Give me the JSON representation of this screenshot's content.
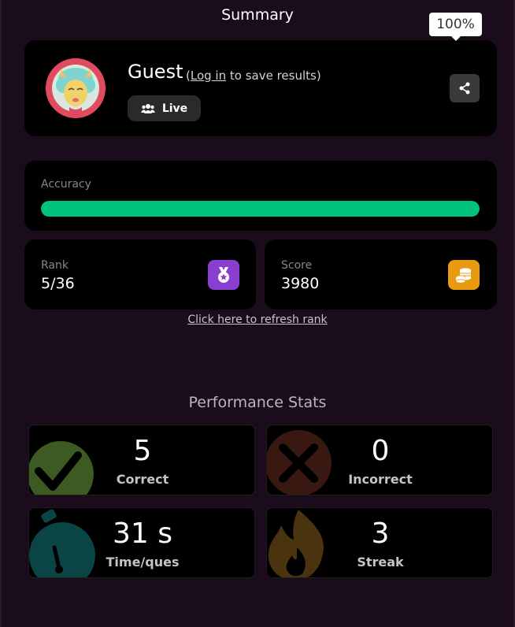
{
  "header": {
    "title": "Summary"
  },
  "profile": {
    "name": "Guest",
    "note_open": "(",
    "login_link": "Log in",
    "note_rest": " to save results)",
    "mode_chip": "Live",
    "avatar_icon": "llama-avatar-icon",
    "share_icon": "share-icon"
  },
  "accuracy": {
    "label": "Accuracy",
    "percent_text": "100%",
    "fraction": 1.0,
    "bar_color": "#00c47c"
  },
  "rank": {
    "label": "Rank",
    "value": "5/36",
    "icon": "medal-icon",
    "icon_color": "#8a3ed0"
  },
  "score": {
    "label": "Score",
    "value": "3980",
    "icon": "coins-icon",
    "icon_color": "#e89a10"
  },
  "refresh_link": "Click here to refresh rank",
  "performance": {
    "title": "Performance Stats",
    "stats": [
      {
        "value": "5",
        "label": "Correct",
        "icon": "checkmark-icon",
        "color": "#4a6a2a"
      },
      {
        "value": "0",
        "label": "Incorrect",
        "icon": "cross-icon",
        "color": "#3a1a14"
      },
      {
        "value": "31 s",
        "label": "Time/ques",
        "icon": "stopwatch-icon",
        "color": "#0a4a4a"
      },
      {
        "value": "3",
        "label": "Streak",
        "icon": "flame-icon",
        "color": "#4a3410"
      }
    ]
  }
}
